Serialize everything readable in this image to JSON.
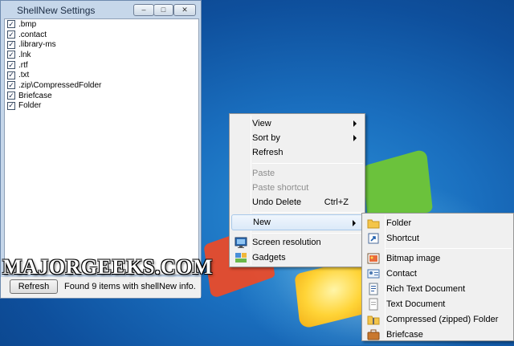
{
  "window": {
    "title": "ShellNew Settings",
    "controls": {
      "minimize": "▭",
      "maximize": "□",
      "close": "✕"
    },
    "items": [
      {
        "label": ".bmp",
        "checked": true
      },
      {
        "label": ".contact",
        "checked": true
      },
      {
        "label": ".library-ms",
        "checked": true
      },
      {
        "label": ".lnk",
        "checked": true
      },
      {
        "label": ".rtf",
        "checked": true
      },
      {
        "label": ".txt",
        "checked": true
      },
      {
        "label": ".zip\\CompressedFolder",
        "checked": true
      },
      {
        "label": "Briefcase",
        "checked": true
      },
      {
        "label": "Folder",
        "checked": true
      }
    ],
    "refresh_label": "Refresh",
    "status": "Found 9 items with shellNew info."
  },
  "watermark": "MAJORGEEKS.COM",
  "context_menu": {
    "items": [
      {
        "label": "View",
        "submenu": true
      },
      {
        "label": "Sort by",
        "submenu": true
      },
      {
        "label": "Refresh"
      },
      {
        "label": "Paste",
        "disabled": true
      },
      {
        "label": "Paste shortcut",
        "disabled": true
      },
      {
        "label": "Undo Delete",
        "shortcut": "Ctrl+Z"
      },
      {
        "label": "New",
        "submenu": true,
        "highlighted": true
      },
      {
        "label": "Screen resolution",
        "icon": "screen-resolution-icon"
      },
      {
        "label": "Gadgets",
        "icon": "gadgets-icon"
      }
    ]
  },
  "new_submenu": {
    "items": [
      {
        "label": "Folder",
        "icon": "folder-icon"
      },
      {
        "label": "Shortcut",
        "icon": "shortcut-icon"
      },
      {
        "label": "Bitmap image",
        "icon": "bitmap-icon"
      },
      {
        "label": "Contact",
        "icon": "contact-icon"
      },
      {
        "label": "Rich Text Document",
        "icon": "rich-text-icon"
      },
      {
        "label": "Text Document",
        "icon": "text-document-icon"
      },
      {
        "label": "Compressed (zipped) Folder",
        "icon": "zip-folder-icon"
      },
      {
        "label": "Briefcase",
        "icon": "briefcase-icon"
      }
    ]
  },
  "colors": {
    "desktop": "#1a6fbf",
    "menu_bg": "#f0f0f0",
    "highlight": "#dbe9f8",
    "window_frame": "#c6d7ea"
  }
}
